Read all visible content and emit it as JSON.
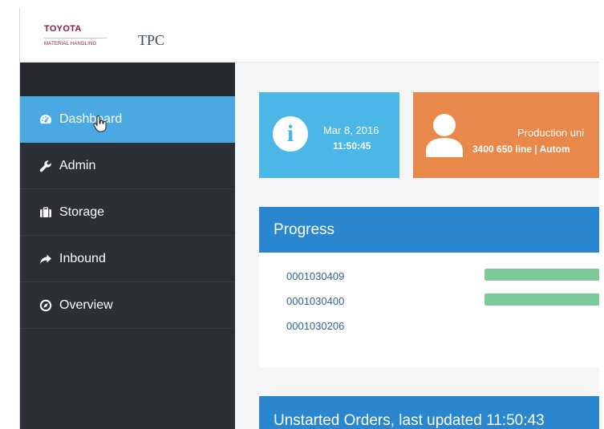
{
  "brand": {
    "logo_top": "TOYOTA",
    "logo_bottom": "MATERIAL HANDLING",
    "app_title": "TPC"
  },
  "sidebar": {
    "items": [
      {
        "label": "Dashboard",
        "icon": "dashboard-icon",
        "active": true
      },
      {
        "label": "Admin",
        "icon": "wrench-icon",
        "active": false
      },
      {
        "label": "Storage",
        "icon": "briefcase-icon",
        "active": false
      },
      {
        "label": "Inbound",
        "icon": "arrow-share-icon",
        "active": false
      },
      {
        "label": "Overview",
        "icon": "compass-icon",
        "active": false
      }
    ]
  },
  "info_card": {
    "icon": "info-icon",
    "date": "Mar 8, 2016",
    "time": "11:50:45"
  },
  "production_card": {
    "icon": "user-icon",
    "title": "Production uni",
    "line": "3400 650 line | Autom"
  },
  "progress": {
    "title": "Progress",
    "orders": [
      {
        "id": "0001030409",
        "progress": 0.75
      },
      {
        "id": "0001030400",
        "progress": 0.75
      },
      {
        "id": "0001030206",
        "progress": 0
      }
    ]
  },
  "unstarted": {
    "title": "Unstarted Orders, last updated 11:50:43"
  },
  "colors": {
    "sidebar_bg": "#2c2f33",
    "active_item": "#4aa8e3",
    "info_card": "#4ab7e6",
    "production_card": "#e8884b",
    "panel_header": "#2a86cf",
    "progress_bar": "#7dc99a",
    "brand": "#8c1b3a"
  }
}
